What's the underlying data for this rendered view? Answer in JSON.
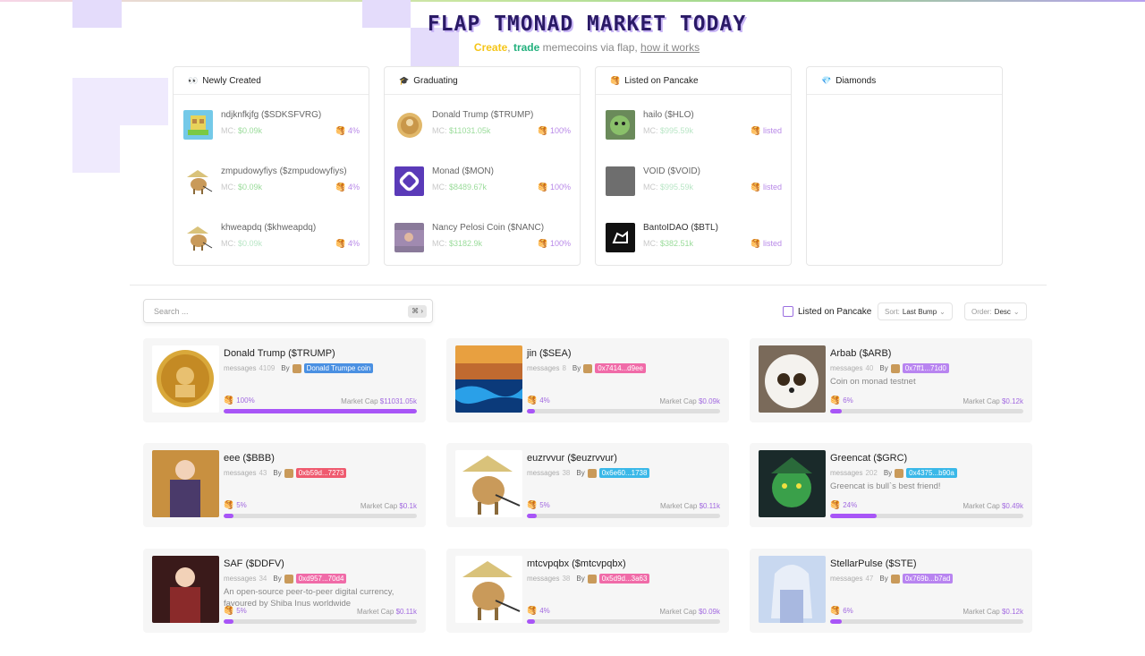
{
  "hero": {
    "title": "FLAP TMONAD MARKET TODAY",
    "create": "Create",
    "comma": ",",
    "trade": "trade",
    "middle": "memecoins via flap,",
    "how": "how it works"
  },
  "panels": [
    {
      "title": "Newly Created",
      "icon": "eyes-icon",
      "rows": [
        {
          "name": "ndjknfkjfg ($SDKSFVRG)",
          "mc_label": "MC:",
          "mc": "$0.09k",
          "status": "4%"
        },
        {
          "name": "zmpudowyfiys ($zmpudowyfiys)",
          "mc_label": "MC:",
          "mc": "$0.09k",
          "status": "4%"
        },
        {
          "name": "khweapdq ($khweapdq)",
          "mc_label": "MC:",
          "mc": "$0.09k",
          "status": "4%"
        }
      ]
    },
    {
      "title": "Graduating",
      "icon": "graduation-cap-icon",
      "rows": [
        {
          "name": "Donald Trump ($TRUMP)",
          "mc_label": "MC:",
          "mc": "$11031.05k",
          "status": "100%"
        },
        {
          "name": "Monad ($MON)",
          "mc_label": "MC:",
          "mc": "$8489.67k",
          "status": "100%"
        },
        {
          "name": "Nancy Pelosi Coin ($NANC)",
          "mc_label": "MC:",
          "mc": "$3182.9k",
          "status": "100%"
        }
      ]
    },
    {
      "title": "Listed on Pancake",
      "icon": "pancake-icon",
      "rows": [
        {
          "name": "hailo ($HLO)",
          "mc_label": "MC:",
          "mc": "$995.59k",
          "status": "listed"
        },
        {
          "name": "VOID ($VOID)",
          "mc_label": "MC:",
          "mc": "$995.59k",
          "status": "listed"
        },
        {
          "name": "BantoIDAO ($BTL)",
          "mc_label": "MC:",
          "mc": "$382.51k",
          "status": "listed"
        }
      ]
    },
    {
      "title": "Diamonds",
      "icon": "diamond-icon",
      "rows": []
    }
  ],
  "toolbar": {
    "search_placeholder": "Search ...",
    "shortcut": "⌘ ›",
    "listed_label": "Listed on Pancake",
    "sort_label": "Sort:",
    "sort_value": "Last Bump",
    "order_label": "Order:",
    "order_value": "Desc"
  },
  "cards": [
    {
      "title": "Donald Trump ($TRUMP)",
      "messages_label": "messages",
      "messages": "4109",
      "by": "By",
      "addr": "Donald Trumpe coin",
      "addr_color": "#4a90e2",
      "desc": "",
      "progress_label": "100%",
      "progress": 100,
      "mcap_label": "Market Cap",
      "mcap": "$11031.05k"
    },
    {
      "title": "jin ($SEA)",
      "messages_label": "messages",
      "messages": "8",
      "by": "By",
      "addr": "0x7414...d9ee",
      "addr_color": "#f06ba8",
      "desc": "",
      "progress_label": "4%",
      "progress": 4,
      "mcap_label": "Market Cap",
      "mcap": "$0.09k"
    },
    {
      "title": "Arbab ($ARB)",
      "messages_label": "messages",
      "messages": "40",
      "by": "By",
      "addr": "0x7ff1...71d0",
      "addr_color": "#b884f0",
      "desc": "Coin on monad testnet",
      "progress_label": "6%",
      "progress": 6,
      "mcap_label": "Market Cap",
      "mcap": "$0.12k"
    },
    {
      "title": "eee ($BBB)",
      "messages_label": "messages",
      "messages": "43",
      "by": "By",
      "addr": "0xb59d...7273",
      "addr_color": "#ef5a6f",
      "desc": "",
      "progress_label": "5%",
      "progress": 5,
      "mcap_label": "Market Cap",
      "mcap": "$0.1k"
    },
    {
      "title": "euzrvvur ($euzrvvur)",
      "messages_label": "messages",
      "messages": "38",
      "by": "By",
      "addr": "0x6e60...1738",
      "addr_color": "#3ab8e8",
      "desc": "",
      "progress_label": "5%",
      "progress": 5,
      "mcap_label": "Market Cap",
      "mcap": "$0.11k"
    },
    {
      "title": "Greencat ($GRC)",
      "messages_label": "messages",
      "messages": "202",
      "by": "By",
      "addr": "0x4375...b90a",
      "addr_color": "#3ab8e8",
      "desc": "Greencat is bull`s best friend!",
      "progress_label": "24%",
      "progress": 24,
      "mcap_label": "Market Cap",
      "mcap": "$0.49k"
    },
    {
      "title": "SAF ($DDFV)",
      "messages_label": "messages",
      "messages": "34",
      "by": "By",
      "addr": "0xd957...70d4",
      "addr_color": "#f06ba8",
      "desc": "An open-source peer-to-peer digital currency, favoured by Shiba Inus worldwide",
      "progress_label": "5%",
      "progress": 5,
      "mcap_label": "Market Cap",
      "mcap": "$0.11k"
    },
    {
      "title": "mtcvpqbx ($mtcvpqbx)",
      "messages_label": "messages",
      "messages": "38",
      "by": "By",
      "addr": "0x5d9d...3a63",
      "addr_color": "#f06ba8",
      "desc": "",
      "progress_label": "4%",
      "progress": 4,
      "mcap_label": "Market Cap",
      "mcap": "$0.09k"
    },
    {
      "title": "StellarPulse ($STE)",
      "messages_label": "messages",
      "messages": "47",
      "by": "By",
      "addr": "0x769b...b7ad",
      "addr_color": "#b884f0",
      "desc": "",
      "progress_label": "6%",
      "progress": 6,
      "mcap_label": "Market Cap",
      "mcap": "$0.12k"
    }
  ]
}
